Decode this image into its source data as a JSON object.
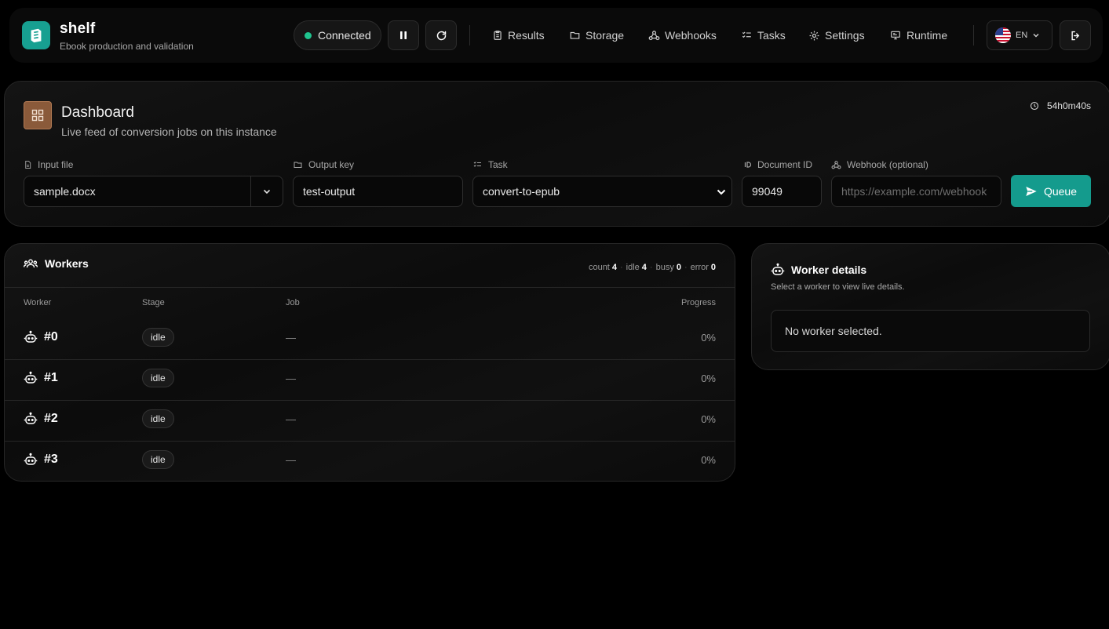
{
  "header": {
    "brand_name": "shelf",
    "brand_subtitle": "Ebook production and validation",
    "connection_status": "Connected",
    "nav": [
      {
        "label": "Results",
        "icon": "clipboard-icon"
      },
      {
        "label": "Storage",
        "icon": "folder-icon"
      },
      {
        "label": "Webhooks",
        "icon": "webhook-icon"
      },
      {
        "label": "Tasks",
        "icon": "list-checks-icon"
      },
      {
        "label": "Settings",
        "icon": "gear-icon"
      },
      {
        "label": "Runtime",
        "icon": "monitor-icon"
      }
    ],
    "language": "EN"
  },
  "dashboard": {
    "title": "Dashboard",
    "subtitle": "Live feed of conversion jobs on this instance",
    "uptime": "54h0m40s",
    "form": {
      "input_file_label": "Input file",
      "input_file_value": "sample.docx",
      "output_key_label": "Output key",
      "output_key_value": "test-output",
      "task_label": "Task",
      "task_value": "convert-to-epub",
      "document_id_label": "Document ID",
      "document_id_value": "99049",
      "webhook_label": "Webhook (optional)",
      "webhook_placeholder": "https://example.com/webhook",
      "queue_label": "Queue"
    }
  },
  "workers": {
    "title": "Workers",
    "stats": {
      "count_label": "count",
      "count": "4",
      "idle_label": "idle",
      "idle": "4",
      "busy_label": "busy",
      "busy": "0",
      "error_label": "error",
      "error": "0"
    },
    "columns": {
      "worker": "Worker",
      "stage": "Stage",
      "job": "Job",
      "progress": "Progress"
    },
    "rows": [
      {
        "id": "#0",
        "stage": "idle",
        "job": "—",
        "progress": "0%"
      },
      {
        "id": "#1",
        "stage": "idle",
        "job": "—",
        "progress": "0%"
      },
      {
        "id": "#2",
        "stage": "idle",
        "job": "—",
        "progress": "0%"
      },
      {
        "id": "#3",
        "stage": "idle",
        "job": "—",
        "progress": "0%"
      }
    ]
  },
  "worker_details": {
    "title": "Worker details",
    "subtitle": "Select a worker to view live details.",
    "empty_text": "No worker selected."
  },
  "colors": {
    "accent": "#149b8d",
    "connected": "#1fc48f",
    "dashboard_icon": "#8a5a3a"
  }
}
